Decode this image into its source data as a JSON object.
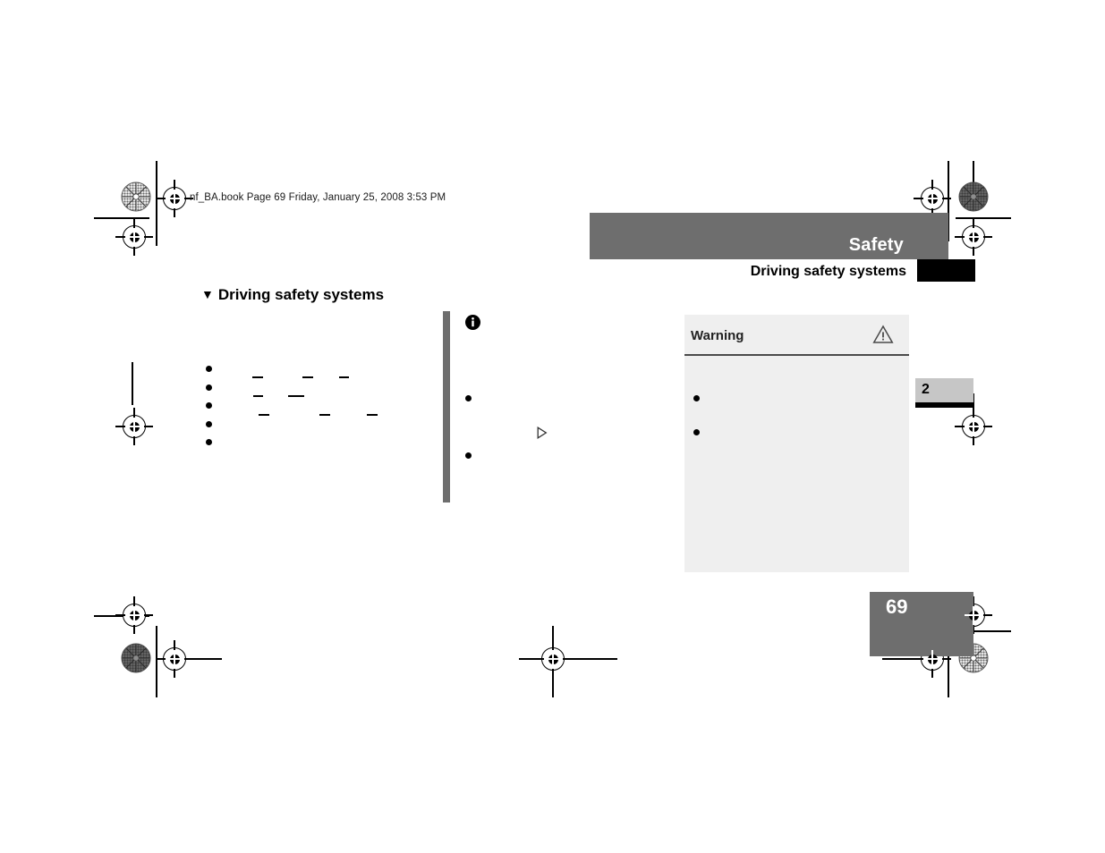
{
  "document": {
    "file_slug": "nf_BA.book  Page 69  Friday, January 25, 2008  3:53 PM",
    "page_number": "69",
    "chapter_number": "2"
  },
  "header": {
    "chapter_title": "Safety",
    "section_title": "Driving safety systems"
  },
  "body": {
    "section_heading": "Driving safety systems",
    "section_heading_marker": "▼",
    "left_column_bullets": [
      "",
      "",
      "",
      "",
      ""
    ],
    "left_column_residual_dashes": [
      "–",
      "–",
      "–",
      "–",
      "–",
      "–",
      "–",
      "–",
      "–"
    ],
    "continuation_marker": "▷"
  },
  "note": {
    "icon": "info-icon",
    "bullets": [
      "",
      ""
    ]
  },
  "warning": {
    "title": "Warning",
    "icon": "warning-triangle-icon",
    "bullets": [
      "",
      ""
    ]
  },
  "colors": {
    "header_band": "#6e6e6e",
    "header_blackbox": "#000000",
    "warning_background": "#efefef",
    "warning_divider": "#4a4a4a",
    "chapter_tab": "#c6c6c6",
    "folio_box": "#6e6e6e",
    "change_bar": "#6e6e6e"
  }
}
